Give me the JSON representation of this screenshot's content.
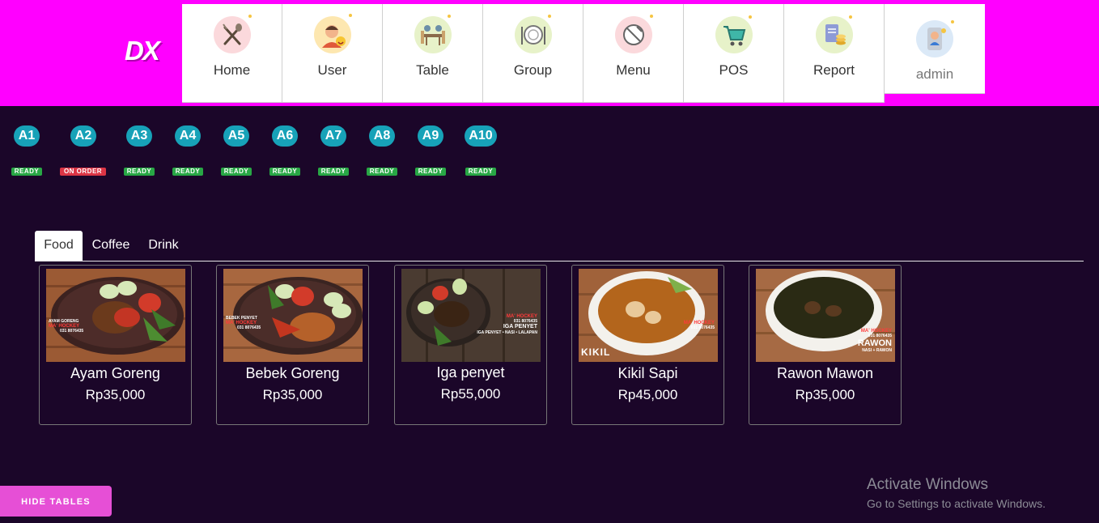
{
  "header": {
    "logo": "DX",
    "nav": [
      {
        "label": "Home",
        "icon": "utensils-icon"
      },
      {
        "label": "User",
        "icon": "user-avatar-icon"
      },
      {
        "label": "Table",
        "icon": "dining-table-icon"
      },
      {
        "label": "Group",
        "icon": "plate-icon"
      },
      {
        "label": "Menu",
        "icon": "menu-plate-icon"
      },
      {
        "label": "POS",
        "icon": "cart-icon"
      },
      {
        "label": "Report",
        "icon": "report-coins-icon"
      },
      {
        "label": "admin",
        "icon": "admin-avatar-icon"
      }
    ]
  },
  "tables": [
    {
      "name": "A1",
      "status": "READY"
    },
    {
      "name": "A2",
      "status": "ON ORDER"
    },
    {
      "name": "A3",
      "status": "READY"
    },
    {
      "name": "A4",
      "status": "READY"
    },
    {
      "name": "A5",
      "status": "READY"
    },
    {
      "name": "A6",
      "status": "READY"
    },
    {
      "name": "A7",
      "status": "READY"
    },
    {
      "name": "A8",
      "status": "READY"
    },
    {
      "name": "A9",
      "status": "READY"
    },
    {
      "name": "A10",
      "status": "READY"
    }
  ],
  "tabs": [
    {
      "label": "Food",
      "active": true
    },
    {
      "label": "Coffee",
      "active": false
    },
    {
      "label": "Drink",
      "active": false
    }
  ],
  "products": [
    {
      "name": "Ayam Goreng",
      "price": "Rp35,000",
      "image_text": [
        "AYAM GORENG",
        "MA' HOCKEY",
        "031 8076435"
      ]
    },
    {
      "name": "Bebek Goreng",
      "price": "Rp35,000",
      "image_text": [
        "BEBEK PENYET",
        "MA' HOCKEY",
        "031 8076435"
      ]
    },
    {
      "name": "Iga penyet",
      "price": "Rp55,000",
      "image_text": [
        "MA' HOCKEY",
        "031 8076435",
        "IGA PENYET",
        "IGA PENYET • NASI • LALAPAN"
      ]
    },
    {
      "name": "Kikil Sapi",
      "price": "Rp45,000",
      "image_text": [
        "KIKIL",
        "MA' HOCKEY",
        "031 8076435"
      ]
    },
    {
      "name": "Rawon Mawon",
      "price": "Rp35,000",
      "image_text": [
        "MA' HOCKEY",
        "031 8076435",
        "RAWON",
        "NASI + RAWON"
      ]
    }
  ],
  "buttons": {
    "hide_tables": "HIDE TABLES"
  },
  "watermark": {
    "line1": "Activate Windows",
    "line2": "Go to Settings to activate Windows."
  },
  "colors": {
    "topbar": "#ff00ff",
    "background": "#1b0629",
    "table_pill": "#17a2b8",
    "ready": "#28a745",
    "on_order": "#dc3545",
    "hide_button": "#e64fd6"
  }
}
